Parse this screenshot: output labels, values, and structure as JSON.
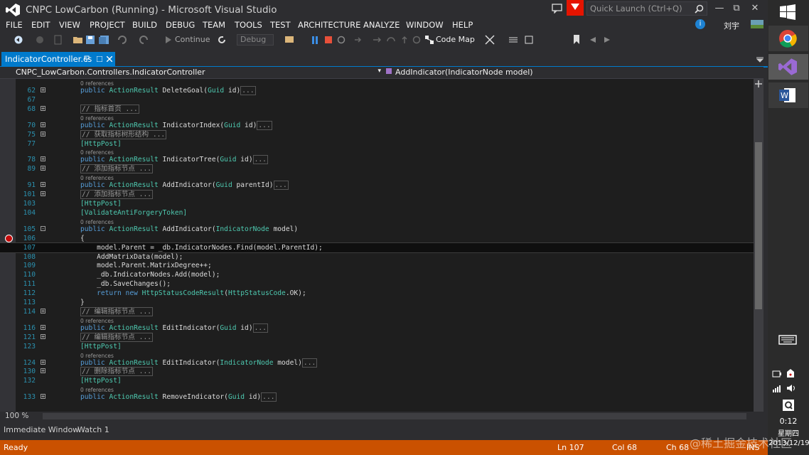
{
  "window": {
    "title": "CNPC LowCarbon (Running) - Microsoft Visual Studio",
    "quick_launch_placeholder": "Quick Launch (Ctrl+Q)",
    "user": "刘宇"
  },
  "menu": [
    "FILE",
    "EDIT",
    "VIEW",
    "PROJECT",
    "BUILD",
    "DEBUG",
    "TEAM",
    "TOOLS",
    "TEST",
    "ARCHITECTURE",
    "ANALYZE",
    "WINDOW",
    "HELP"
  ],
  "toolbar": {
    "continue_label": "Continue",
    "config_value": "Debug",
    "codemap_label": "Code Map"
  },
  "tab": {
    "name": "IndicatorController.cs"
  },
  "nav": {
    "class": "CNPC_LowCarbon.Controllers.IndicatorController",
    "member": "AddIndicator(IndicatorNode model)"
  },
  "refs_label": "0 references",
  "code": [
    {
      "ln": "62",
      "fold": "+",
      "text": "public ActionResult DeleteGoal(Guid id)"
    },
    {
      "ln": "67",
      "fold": "",
      "text": ""
    },
    {
      "ln": "68",
      "fold": "+",
      "text": "// 指标首页 ..."
    },
    {
      "ln": "70",
      "fold": "+",
      "text": "public ActionResult IndicatorIndex(Guid id)"
    },
    {
      "ln": "75",
      "fold": "+",
      "text": "// 获取指标树形结构 ..."
    },
    {
      "ln": "77",
      "fold": "",
      "text": "[HttpPost]"
    },
    {
      "ln": "78",
      "fold": "+",
      "text": "public ActionResult IndicatorTree(Guid id)"
    },
    {
      "ln": "89",
      "fold": "+",
      "text": "// 添加指标节点 ..."
    },
    {
      "ln": "91",
      "fold": "+",
      "text": "public ActionResult AddIndicator(Guid parentId)"
    },
    {
      "ln": "101",
      "fold": "+",
      "text": "// 添加指标节点 ..."
    },
    {
      "ln": "103",
      "fold": "",
      "text": "[HttpPost]"
    },
    {
      "ln": "104",
      "fold": "",
      "text": "[ValidateAntiForgeryToken]"
    },
    {
      "ln": "105",
      "fold": "-",
      "text": "public ActionResult AddIndicator(IndicatorNode model)"
    },
    {
      "ln": "106",
      "fold": "",
      "text": "{"
    },
    {
      "ln": "107",
      "fold": "",
      "text": "    model.Parent = _db.IndicatorNodes.Find(model.ParentId);"
    },
    {
      "ln": "108",
      "fold": "",
      "text": "    AddMatrixData(model);"
    },
    {
      "ln": "109",
      "fold": "",
      "text": "    model.Parent.MatrixDegree++;"
    },
    {
      "ln": "110",
      "fold": "",
      "text": "    _db.IndicatorNodes.Add(model);"
    },
    {
      "ln": "111",
      "fold": "",
      "text": "    _db.SaveChanges();"
    },
    {
      "ln": "112",
      "fold": "",
      "text": "    return new HttpStatusCodeResult(HttpStatusCode.OK);"
    },
    {
      "ln": "113",
      "fold": "",
      "text": "}"
    },
    {
      "ln": "114",
      "fold": "+",
      "text": "// 编辑指标节点 ..."
    },
    {
      "ln": "116",
      "fold": "+",
      "text": "public ActionResult EditIndicator(Guid id)"
    },
    {
      "ln": "121",
      "fold": "+",
      "text": "// 编辑指标节点 ..."
    },
    {
      "ln": "123",
      "fold": "",
      "text": "[HttpPost]"
    },
    {
      "ln": "124",
      "fold": "+",
      "text": "public ActionResult EditIndicator(IndicatorNode model)"
    },
    {
      "ln": "130",
      "fold": "+",
      "text": "// 删除指标节点 ..."
    },
    {
      "ln": "132",
      "fold": "",
      "text": "[HttpPost]"
    },
    {
      "ln": "133",
      "fold": "+",
      "text": "public ActionResult RemoveIndicator(Guid id)"
    }
  ],
  "editor": {
    "zoom": "100 %"
  },
  "bottom_tabs": [
    "Immediate Window",
    "Watch 1"
  ],
  "status": {
    "state": "Ready",
    "ln": "Ln 107",
    "col": "Col 68",
    "ch": "Ch 68",
    "ins": "INS"
  },
  "taskbar": {
    "time": "0:12",
    "weekday": "星期四",
    "date": "2013/12/19"
  },
  "watermark": "@稀土掘金技术社区",
  "colors": {
    "accent": "#007acc",
    "status_debug": "#ca5100",
    "breakpoint": "#c50b0b"
  }
}
